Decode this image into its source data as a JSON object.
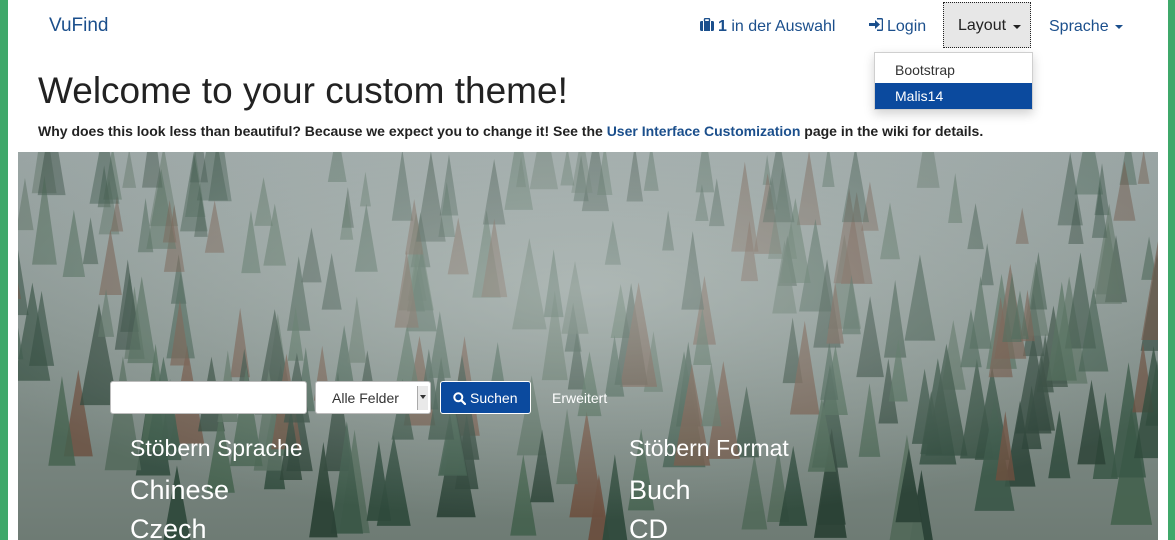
{
  "navbar": {
    "brand": "VuFind",
    "cart_count": "1",
    "cart_label": "in der Auswahl",
    "login_label": "Login",
    "layout_label": "Layout",
    "language_label": "Sprache",
    "layout_menu": [
      {
        "label": "Bootstrap",
        "active": false
      },
      {
        "label": "Malis14",
        "active": true
      }
    ]
  },
  "heading": {
    "title": "Welcome to your custom theme!",
    "intro_before": "Why does this look less than beautiful? Because we expect you to change it! See the ",
    "intro_link": "User Interface Customization",
    "intro_after": " page in the wiki for details."
  },
  "search": {
    "query": "",
    "field_select": "Alle Felder",
    "submit_label": "Suchen",
    "advanced_label": "Erweitert"
  },
  "browse": {
    "language": {
      "heading": "Stöbern Sprache",
      "items": [
        "Chinese",
        "Czech"
      ]
    },
    "format": {
      "heading": "Stöbern Format",
      "items": [
        "Buch",
        "CD"
      ]
    }
  },
  "colors": {
    "link": "#1b4f8c",
    "primary": "#0b4a9e",
    "frame": "#3fa86a"
  },
  "icons": [
    "briefcase-icon",
    "sign-in-icon",
    "search-icon"
  ]
}
